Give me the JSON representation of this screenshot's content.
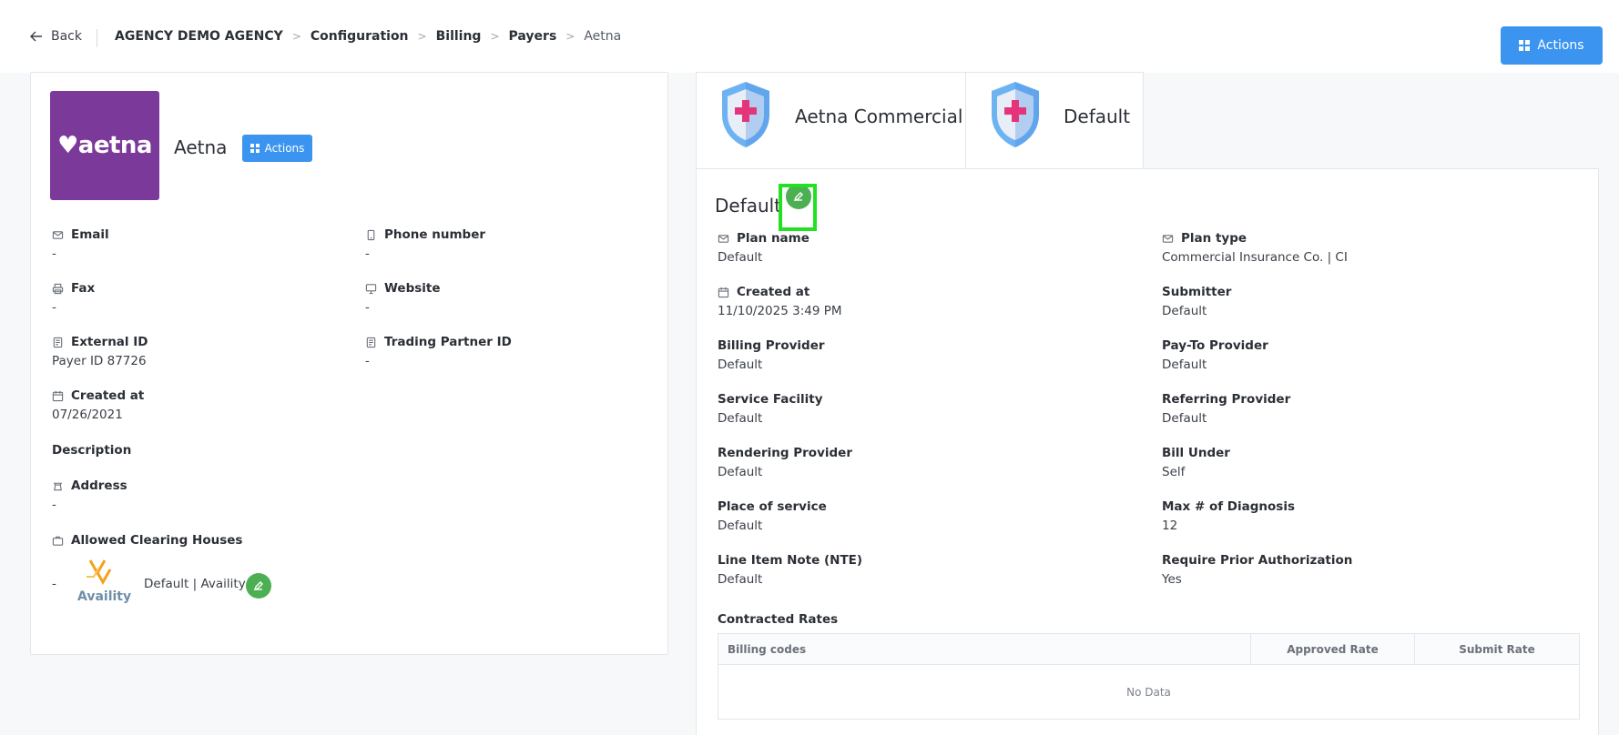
{
  "header": {
    "back_label": "Back",
    "breadcrumbs": [
      "AGENCY DEMO AGENCY",
      "Configuration",
      "Billing",
      "Payers",
      "Aetna"
    ],
    "actions_label": "Actions",
    "accent_color": "#3b95f0"
  },
  "payer": {
    "logo_text": "♥aetna",
    "name": "Aetna",
    "actions_label": "Actions",
    "fields": {
      "email": {
        "label": "Email",
        "value": "-"
      },
      "phone": {
        "label": "Phone number",
        "value": "-"
      },
      "fax": {
        "label": "Fax",
        "value": "-"
      },
      "website": {
        "label": "Website",
        "value": "-"
      },
      "external_id": {
        "label": "External ID",
        "value": "Payer ID 87726"
      },
      "trading_partner_id": {
        "label": "Trading Partner ID",
        "value": "-"
      },
      "created_at": {
        "label": "Created at",
        "value": "07/26/2021"
      },
      "description": {
        "label": "Description"
      },
      "address": {
        "label": "Address",
        "value": "-"
      },
      "clearing_houses": {
        "label": "Allowed Clearing Houses"
      }
    },
    "clearing_house": {
      "dash": "-",
      "logo_text": "Availity",
      "label": "Default | Availity"
    }
  },
  "plan_tabs": [
    {
      "label": "Aetna Commercial"
    },
    {
      "label": "Default"
    }
  ],
  "plan": {
    "title": "Default",
    "fields": {
      "plan_name": {
        "label": "Plan name",
        "value": "Default"
      },
      "plan_type": {
        "label": "Plan type",
        "value": "Commercial Insurance Co. | CI"
      },
      "created_at": {
        "label": "Created at",
        "value": "11/10/2025 3:49 PM"
      },
      "submitter": {
        "label": "Submitter",
        "value": "Default"
      },
      "billing_provider": {
        "label": "Billing Provider",
        "value": "Default"
      },
      "pay_to_provider": {
        "label": "Pay-To Provider",
        "value": "Default"
      },
      "service_facility": {
        "label": "Service Facility",
        "value": "Default"
      },
      "referring_provider": {
        "label": "Referring Provider",
        "value": "Default"
      },
      "rendering_provider": {
        "label": "Rendering Provider",
        "value": "Default"
      },
      "bill_under": {
        "label": "Bill Under",
        "value": "Self"
      },
      "place_of_service": {
        "label": "Place of service",
        "value": "Default"
      },
      "max_diagnosis": {
        "label": "Max # of Diagnosis",
        "value": "12"
      },
      "line_item_note": {
        "label": "Line Item Note (NTE)",
        "value": "Default"
      },
      "require_prior_auth": {
        "label": "Require Prior Authorization",
        "value": "Yes"
      }
    },
    "rates": {
      "title": "Contracted Rates",
      "columns": [
        "Billing codes",
        "Approved Rate",
        "Submit Rate"
      ],
      "empty_text": "No Data"
    }
  }
}
